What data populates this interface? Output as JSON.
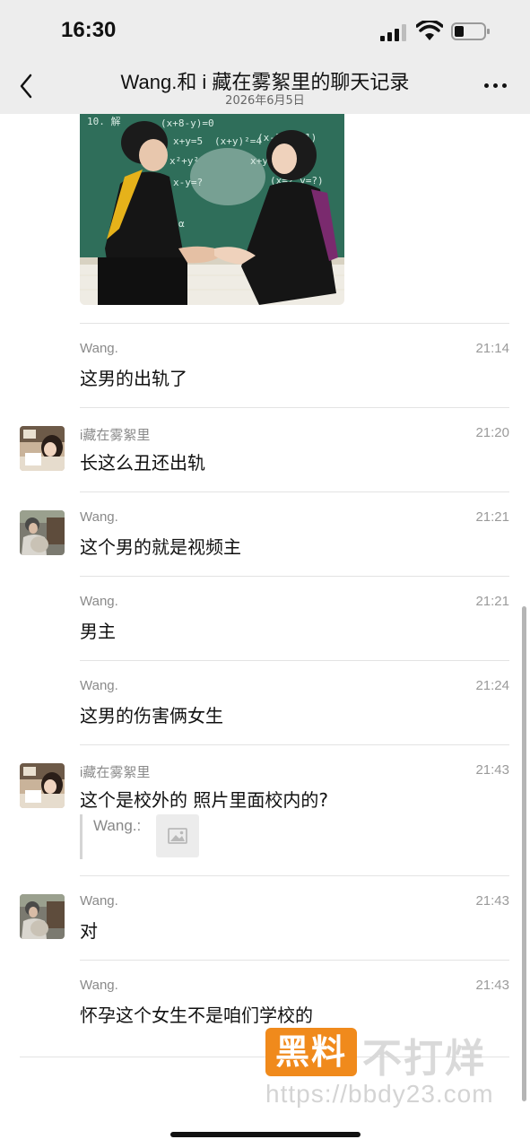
{
  "status_bar": {
    "time": "16:30",
    "icons": [
      "signal-icon",
      "wifi-icon",
      "battery-icon"
    ]
  },
  "header": {
    "title": "Wang.和 i 藏在雾絮里的聊天记录",
    "subtitle": "2026年6月5日",
    "back_icon": "chevron-left-icon",
    "more_icon": "more-dots-icon"
  },
  "photo": {
    "board_text": [
      "10. 解",
      "(x+8-y)=0",
      "x+y=5",
      "(x+y)²=4",
      "x²+y²",
      "x-y=?",
      "(x-1)(x+1)",
      "x+y=(x+y)",
      "(x=2 y=?)",
      "α"
    ]
  },
  "messages": [
    {
      "sender": "Wang.",
      "time": "21:14",
      "text": "这男的出轨了",
      "avatar": false
    },
    {
      "sender": "i藏在雾絮里",
      "time": "21:20",
      "text": "长这么丑还出轨",
      "avatar": true
    },
    {
      "sender": "Wang.",
      "time": "21:21",
      "text": "这个男的就是视频主",
      "avatar": true
    },
    {
      "sender": "Wang.",
      "time": "21:21",
      "text": "男主",
      "avatar": false
    },
    {
      "sender": "Wang.",
      "time": "21:24",
      "text": "这男的伤害俩女生",
      "avatar": false
    },
    {
      "sender": "i藏在雾絮里",
      "time": "21:43",
      "text": "这个是校外的 照片里面校内的?",
      "avatar": true,
      "quote": {
        "name": "Wang.:",
        "thumb_icon": "image-icon"
      }
    },
    {
      "sender": "Wang.",
      "time": "21:43",
      "text": "对",
      "avatar": true
    },
    {
      "sender": "Wang.",
      "time": "21:43",
      "text": "怀孕这个女生不是咱们学校的",
      "avatar": false
    }
  ],
  "watermark": {
    "logo": "黑料",
    "text": "不打烊",
    "url": "https://bbdy23.com"
  },
  "colors": {
    "header_bg": "#ededed",
    "text": "#111111",
    "meta": "#8a8a8a",
    "divider": "#e3e3e3",
    "watermark_orange": "#f08a1c"
  }
}
